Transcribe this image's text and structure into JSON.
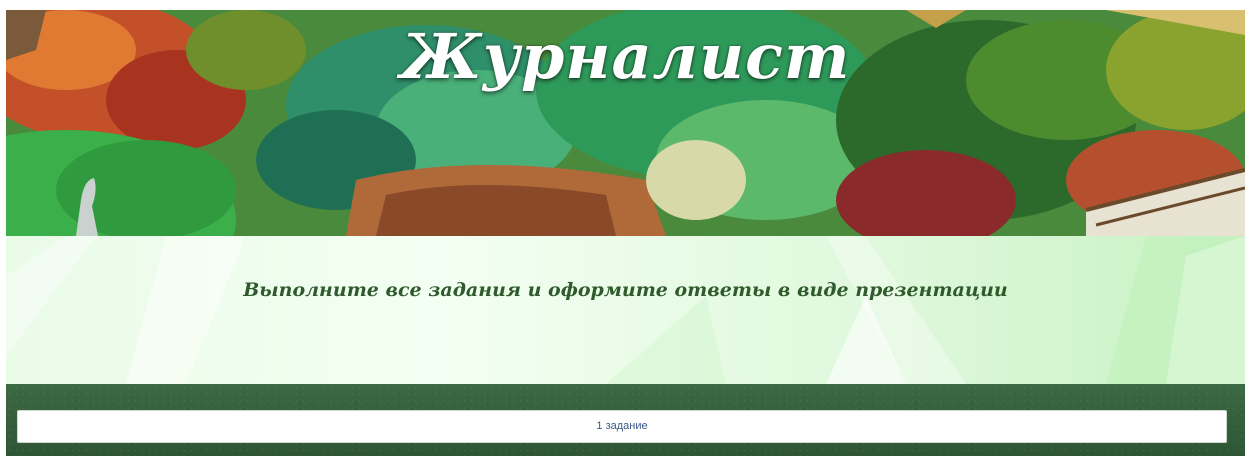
{
  "banner": {
    "title": "Журналист"
  },
  "instruction": {
    "text": "Выполните все задания и оформите ответы в виде презентации"
  },
  "tasks": {
    "items": [
      {
        "label": "1 задание"
      }
    ]
  },
  "colors": {
    "title": "#ffffff",
    "instruction_text": "#2f5a2c",
    "band_background": "#eafbe8",
    "footer_background": "#355f3b",
    "button_text": "#3a5a8a"
  }
}
